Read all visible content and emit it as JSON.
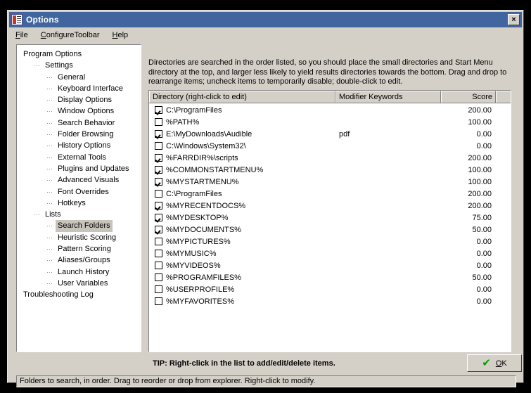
{
  "window": {
    "title": "Options",
    "icon": "options-list-icon",
    "close_label": "×"
  },
  "menubar": {
    "items": [
      {
        "pre": "",
        "accel": "F",
        "post": "ile"
      },
      {
        "pre": "",
        "accel": "C",
        "post": "onfigureToolbar"
      },
      {
        "pre": "",
        "accel": "H",
        "post": "elp"
      }
    ]
  },
  "tree": {
    "selected": "Search Folders",
    "items": [
      {
        "label": "Program Options",
        "depth": 0,
        "branch": false
      },
      {
        "label": "Settings",
        "depth": 1,
        "branch": true
      },
      {
        "label": "General",
        "depth": 2,
        "branch": true
      },
      {
        "label": "Keyboard Interface",
        "depth": 2,
        "branch": true
      },
      {
        "label": "Display Options",
        "depth": 2,
        "branch": true
      },
      {
        "label": "Window Options",
        "depth": 2,
        "branch": true
      },
      {
        "label": "Search Behavior",
        "depth": 2,
        "branch": true
      },
      {
        "label": "Folder Browsing",
        "depth": 2,
        "branch": true
      },
      {
        "label": "History Options",
        "depth": 2,
        "branch": true
      },
      {
        "label": "External Tools",
        "depth": 2,
        "branch": true
      },
      {
        "label": "Plugins and Updates",
        "depth": 2,
        "branch": true
      },
      {
        "label": "Advanced Visuals",
        "depth": 2,
        "branch": true
      },
      {
        "label": "Font Overrides",
        "depth": 2,
        "branch": true
      },
      {
        "label": "Hotkeys",
        "depth": 2,
        "branch": true
      },
      {
        "label": "Lists",
        "depth": 1,
        "branch": true
      },
      {
        "label": "Search Folders",
        "depth": 2,
        "branch": true
      },
      {
        "label": "Heuristic Scoring",
        "depth": 2,
        "branch": true
      },
      {
        "label": "Pattern Scoring",
        "depth": 2,
        "branch": true
      },
      {
        "label": "Aliases/Groups",
        "depth": 2,
        "branch": true
      },
      {
        "label": "Launch History",
        "depth": 2,
        "branch": true
      },
      {
        "label": "User Variables",
        "depth": 2,
        "branch": true
      },
      {
        "label": "Troubleshooting Log",
        "depth": 0,
        "branch": false
      }
    ]
  },
  "main": {
    "description": "Directories are searched in the order listed, so you should place the small directories and Start Menu directory at the top, and larger less likely to yield results directories towards the bottom.  Drag and drop to rearrange items; uncheck items to temporarily disable; double-click to edit.",
    "columns": [
      "Directory (right-click to edit)",
      "Modifier Keywords",
      "Score",
      ""
    ],
    "rows": [
      {
        "checked": true,
        "directory": "C:\\ProgramFiles",
        "modifier": "",
        "score": "200.00"
      },
      {
        "checked": false,
        "directory": "%PATH%",
        "modifier": "",
        "score": "100.00"
      },
      {
        "checked": true,
        "directory": "E:\\MyDownloads\\Audible",
        "modifier": "pdf",
        "score": "0.00"
      },
      {
        "checked": false,
        "directory": "C:\\Windows\\System32\\",
        "modifier": "",
        "score": "0.00"
      },
      {
        "checked": true,
        "directory": "%FARRDIR%\\scripts",
        "modifier": "",
        "score": "200.00"
      },
      {
        "checked": true,
        "directory": "%COMMONSTARTMENU%",
        "modifier": "",
        "score": "100.00"
      },
      {
        "checked": true,
        "directory": "%MYSTARTMENU%",
        "modifier": "",
        "score": "100.00"
      },
      {
        "checked": false,
        "directory": "C:\\ProgramFiles",
        "modifier": "",
        "score": "200.00"
      },
      {
        "checked": true,
        "directory": "%MYRECENTDOCS%",
        "modifier": "",
        "score": "200.00"
      },
      {
        "checked": true,
        "directory": "%MYDESKTOP%",
        "modifier": "",
        "score": "75.00"
      },
      {
        "checked": true,
        "directory": "%MYDOCUMENTS%",
        "modifier": "",
        "score": "50.00"
      },
      {
        "checked": false,
        "directory": "%MYPICTURES%",
        "modifier": "",
        "score": "0.00"
      },
      {
        "checked": false,
        "directory": "%MYMUSIC%",
        "modifier": "",
        "score": "0.00"
      },
      {
        "checked": false,
        "directory": "%MYVIDEOS%",
        "modifier": "",
        "score": "0.00"
      },
      {
        "checked": false,
        "directory": "%PROGRAMFILES%",
        "modifier": "",
        "score": "50.00"
      },
      {
        "checked": false,
        "directory": "%USERPROFILE%",
        "modifier": "",
        "score": "0.00"
      },
      {
        "checked": false,
        "directory": "%MYFAVORITES%",
        "modifier": "",
        "score": "0.00"
      }
    ],
    "tip": "TIP: Right-click in the list to add/edit/delete items.",
    "ok_button": {
      "check_icon": "✔",
      "pre": "",
      "accel": "O",
      "post": "K"
    }
  },
  "statusbar": {
    "text": "Folders to search, in order.  Drag to reorder or drop from explorer. Right-click to modify."
  }
}
